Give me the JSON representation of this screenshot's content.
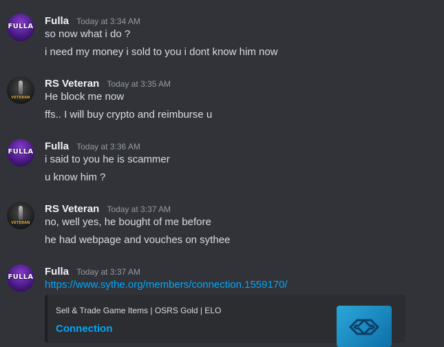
{
  "messages": [
    {
      "author": "Fulla",
      "avatar_text": "FULLA",
      "timestamp": "Today at 3:34 AM",
      "lines": [
        "so now what i do ?",
        "i need my money i sold to you i dont know him now"
      ]
    },
    {
      "author": "RS Veteran",
      "avatar_text": "VETERAN",
      "timestamp": "Today at 3:35 AM",
      "lines": [
        "He block me now",
        "ffs.. I will buy crypto and reimburse u"
      ]
    },
    {
      "author": "Fulla",
      "avatar_text": "FULLA",
      "timestamp": "Today at 3:36 AM",
      "lines": [
        "i said to you he is scammer",
        "u know him ?"
      ]
    },
    {
      "author": "RS Veteran",
      "avatar_text": "VETERAN",
      "timestamp": "Today at 3:37 AM",
      "lines": [
        "no, well yes, he bought of me before",
        "he had webpage and vouches on sythee"
      ]
    },
    {
      "author": "Fulla",
      "avatar_text": "FULLA",
      "timestamp": "Today at 3:37 AM",
      "link": "https://www.sythe.org/members/connection.1559170/",
      "embed": {
        "provider": "Sell & Trade Game Items | OSRS Gold | ELO",
        "title": "Connection",
        "thumbnail_icon": "sythe-logo-icon"
      }
    }
  ],
  "colors": {
    "background": "#313338",
    "text": "#dbdee1",
    "username": "#f2f3f5",
    "timestamp": "#949ba4",
    "link": "#00a8fc",
    "embed_bg": "#2b2d31"
  }
}
